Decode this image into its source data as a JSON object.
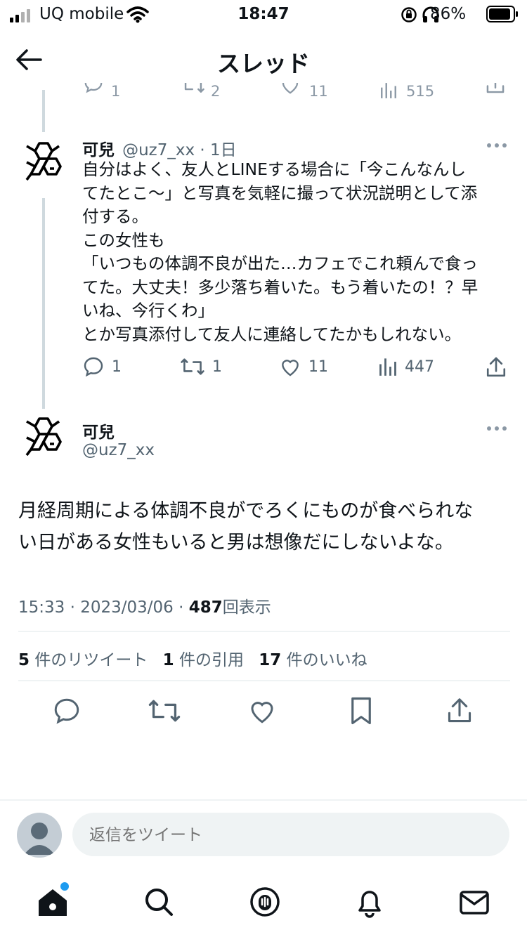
{
  "status_bar": {
    "carrier": "UQ mobile",
    "time": "18:47",
    "battery": "86%"
  },
  "header": {
    "title": "スレッド"
  },
  "prev_tweet_stats": {
    "replies": "1",
    "retweets": "2",
    "likes": "11",
    "views": "515"
  },
  "tweet1": {
    "name": "可兒",
    "handle_time": "@uz7_xx · 1日",
    "body": "自分はよく、友人とLINEする場合に「今こんなんし\nてたとこ〜」と写真を気軽に撮って状況説明として添\n付する。\nこの女性も\n「いつもの体調不良が出た…カフェでこれ頼んで食っ\nてた。大丈夫！多少落ち着いた。もう着いたの！？早\nいね、今行くわ」\nとか写真添付して友人に連絡してたかもしれない。",
    "replies": "1",
    "retweets": "1",
    "likes": "11",
    "views": "447"
  },
  "main_tweet": {
    "name": "可兒",
    "handle": "@uz7_xx",
    "body": "月経周期による体調不良がでろくにものが食べられな\nい日がある女性もいると男は想像だにしないよな。",
    "time_date": "15:33 · 2023/03/06 · ",
    "views_count": "487",
    "views_label": "回表示",
    "retweets_count": "5",
    "retweets_label": "件のリツイート",
    "quotes_count": "1",
    "quotes_label": "件の引用",
    "likes_count": "17",
    "likes_label": "件のいいね"
  },
  "reply_bar": {
    "placeholder": "返信をツイート"
  },
  "colors": {
    "text": "#0f1419",
    "secondary": "#536471",
    "divider": "#eff3f4",
    "badge": "#1d9bf0"
  }
}
